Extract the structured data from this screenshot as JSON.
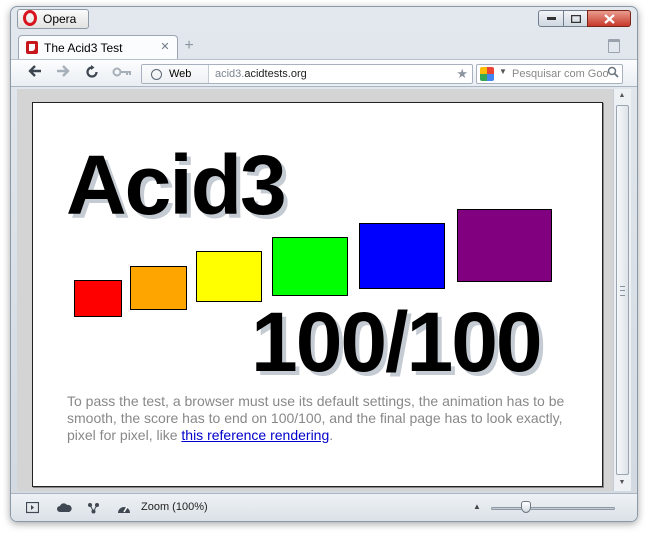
{
  "window": {
    "app_button_label": "Opera",
    "controls": [
      "minimize",
      "maximize",
      "close"
    ]
  },
  "tabs": [
    {
      "title": "The Acid3 Test",
      "active": true
    }
  ],
  "navigation": {
    "address_prefix": "Web",
    "url_host_prefix": "acid3.",
    "url_host_domain": "acidtests.org",
    "search_placeholder": "Pesquisar com Goo"
  },
  "page": {
    "title": "Acid3",
    "score": "100/100",
    "boxes": [
      {
        "color": "#ff0000"
      },
      {
        "color": "#ffa500"
      },
      {
        "color": "#ffff00"
      },
      {
        "color": "#00ff00"
      },
      {
        "color": "#0000ff"
      },
      {
        "color": "#800080"
      }
    ],
    "description_before_link": "To pass the test, a browser must use its default settings, the animation has to be smooth, the score has to end on 100/100, and the final page has to look exactly, pixel for pixel, like ",
    "link_text": "this reference rendering",
    "description_after_link": "."
  },
  "statusbar": {
    "zoom_label": "Zoom (100%)"
  },
  "colors": {
    "link": "#0000cc",
    "description_text": "#888888",
    "close_button": "#c7392a"
  }
}
